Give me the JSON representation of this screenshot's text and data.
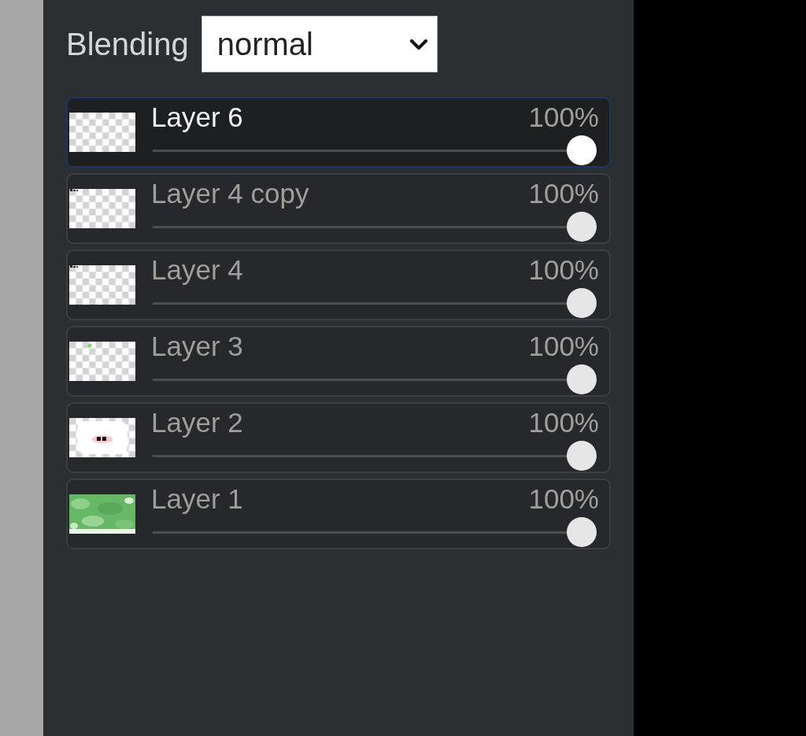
{
  "blending": {
    "label": "Blending",
    "value": "normal"
  },
  "layers": [
    {
      "name": "Layer 6",
      "opacity": "100%",
      "level": 1,
      "selected": true
    },
    {
      "name": "Layer 4 copy",
      "opacity": "100%",
      "level": 1,
      "selected": false
    },
    {
      "name": "Layer 4",
      "opacity": "100%",
      "level": 1,
      "selected": false
    },
    {
      "name": "Layer 3",
      "opacity": "100%",
      "level": 1,
      "selected": false
    },
    {
      "name": "Layer 2",
      "opacity": "100%",
      "level": 1,
      "selected": false
    },
    {
      "name": "Layer 1",
      "opacity": "100%",
      "level": 1,
      "selected": false
    }
  ]
}
